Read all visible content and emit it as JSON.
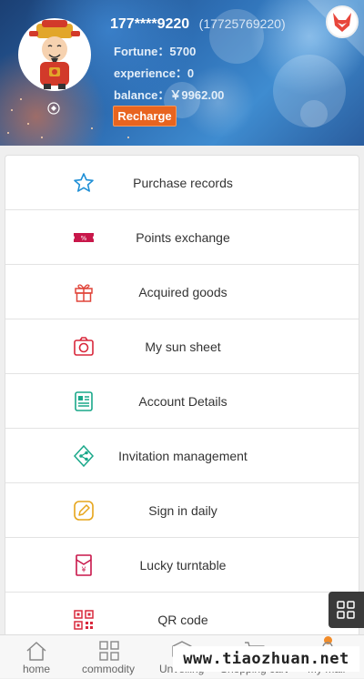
{
  "header": {
    "user_name": "177****9220",
    "user_phone": "(17725769220)",
    "fortune": "Fortune：5700",
    "experience": "experience：0",
    "balance": "balance：￥9962.00",
    "recharge_label": "Recharge"
  },
  "menu": [
    {
      "label": "Purchase records",
      "icon": "star-icon",
      "color": "#1f8fd6"
    },
    {
      "label": "Points exchange",
      "icon": "ticket-icon",
      "color": "#c8174a"
    },
    {
      "label": "Acquired goods",
      "icon": "gift-icon",
      "color": "#e0453a"
    },
    {
      "label": "My sun sheet",
      "icon": "camera-icon",
      "color": "#d9283c"
    },
    {
      "label": "Account Details",
      "icon": "document-icon",
      "color": "#1aa88a"
    },
    {
      "label": "Invitation management",
      "icon": "share-icon",
      "color": "#1aa88a"
    },
    {
      "label": "Sign in daily",
      "icon": "pencil-icon",
      "color": "#e6a51b"
    },
    {
      "label": "Lucky turntable",
      "icon": "red-envelope-icon",
      "color": "#c8174a"
    },
    {
      "label": "QR code",
      "icon": "qr-code-icon",
      "color": "#d9283c"
    }
  ],
  "tabs": [
    {
      "label": "home",
      "icon": "home-icon"
    },
    {
      "label": "commodity",
      "icon": "grid-icon"
    },
    {
      "label": "Unveiling",
      "icon": "box-icon"
    },
    {
      "label": "Shopping cart",
      "icon": "cart-icon"
    },
    {
      "label": "My mall",
      "icon": "user-icon"
    }
  ],
  "watermark": "www.tiaozhuan.net",
  "colors": {
    "accent": "#e8641f",
    "header_blue": "#2e6fb5"
  }
}
